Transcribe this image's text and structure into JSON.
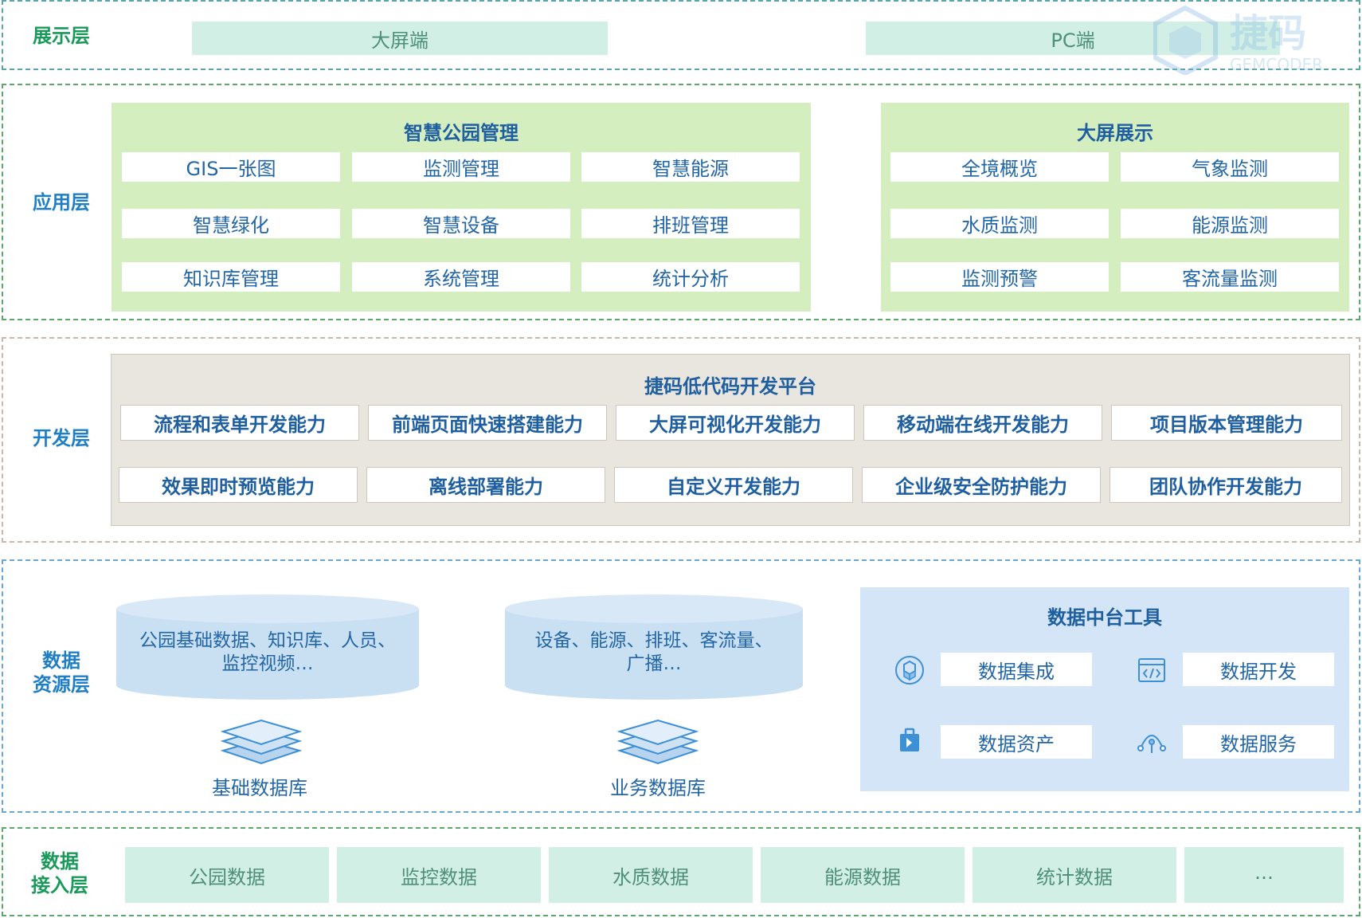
{
  "watermark": {
    "brand": "捷码",
    "brand_en": "GEMCODER"
  },
  "display_layer": {
    "label": "展示层",
    "items": [
      "大屏端",
      "PC端"
    ]
  },
  "app_layer": {
    "label": "应用层",
    "park": {
      "title": "智慧公园管理",
      "items": [
        "GIS一张图",
        "监测管理",
        "智慧能源",
        "智慧绿化",
        "智慧设备",
        "排班管理",
        "知识库管理",
        "系统管理",
        "统计分析"
      ]
    },
    "screen": {
      "title": "大屏展示",
      "items": [
        "全境概览",
        "气象监测",
        "水质监测",
        "能源监测",
        "监测预警",
        "客流量监测"
      ]
    }
  },
  "dev_layer": {
    "label": "开发层",
    "title": "捷码低代码开发平台",
    "row1": [
      "流程和表单开发能力",
      "前端页面快速搭建能力",
      "大屏可视化开发能力",
      "移动端在线开发能力",
      "项目版本管理能力"
    ],
    "row2": [
      "效果即时预览能力",
      "离线部署能力",
      "自定义开发能力",
      "企业级安全防护能力",
      "团队协作开发能力"
    ]
  },
  "data_layer": {
    "label_line1": "数据",
    "label_line2": "资源层",
    "db1": {
      "line1": "公园基础数据、知识库、人员、",
      "line2": "监控视频…",
      "name": "基础数据库"
    },
    "db2": {
      "line1": "设备、能源、排班、客流量、",
      "line2": "广播…",
      "name": "业务数据库"
    },
    "tools": {
      "title": "数据中台工具",
      "items": [
        {
          "label": "数据集成",
          "icon": "integration-icon"
        },
        {
          "label": "数据开发",
          "icon": "code-icon"
        },
        {
          "label": "数据资产",
          "icon": "asset-icon"
        },
        {
          "label": "数据服务",
          "icon": "service-icon"
        }
      ]
    }
  },
  "access_layer": {
    "label_line1": "数据",
    "label_line2": "接入层",
    "items": [
      "公园数据",
      "监控数据",
      "水质数据",
      "能源数据",
      "统计数据",
      "…"
    ]
  }
}
